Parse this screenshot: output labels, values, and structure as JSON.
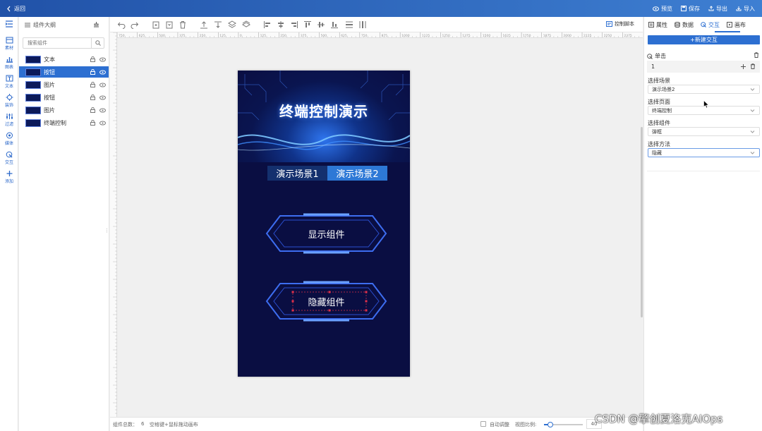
{
  "topbar": {
    "back_label": "返回",
    "actions": [
      {
        "icon": "eye-icon",
        "label": "预览"
      },
      {
        "icon": "save-icon",
        "label": "保存"
      },
      {
        "icon": "export-icon",
        "label": "导出"
      },
      {
        "icon": "import-icon",
        "label": "导入"
      }
    ]
  },
  "leftnav": [
    {
      "icon": "material-icon",
      "label": "素材"
    },
    {
      "icon": "chart-icon",
      "label": "图表"
    },
    {
      "icon": "text-icon",
      "label": "文本"
    },
    {
      "icon": "decoration-icon",
      "label": "装饰"
    },
    {
      "icon": "filter-icon",
      "label": "过滤"
    },
    {
      "icon": "media-icon",
      "label": "媒体"
    },
    {
      "icon": "interaction-icon",
      "label": "交互"
    },
    {
      "icon": "add-icon",
      "label": "添加"
    }
  ],
  "outline": {
    "title": "组件大纲",
    "search_placeholder": "搜索组件",
    "items": [
      {
        "label": "文本",
        "selected": false
      },
      {
        "label": "按钮",
        "selected": true
      },
      {
        "label": "图片",
        "selected": false
      },
      {
        "label": "按钮",
        "selected": false
      },
      {
        "label": "图片",
        "selected": false
      },
      {
        "label": "终端控制",
        "selected": false
      }
    ]
  },
  "toolbar": {
    "control_script_label": "控制脚本"
  },
  "canvas": {
    "title": "终端控制演示",
    "scene_tabs": [
      "演示场景1",
      "演示场景2"
    ],
    "show_button": "显示组件",
    "hide_button": "隐藏组件"
  },
  "rightpanel": {
    "tabs": [
      {
        "icon": "property-icon",
        "label": "属性",
        "active": false
      },
      {
        "icon": "data-icon",
        "label": "数据",
        "active": false
      },
      {
        "icon": "interaction-icon",
        "label": "交互",
        "active": true
      },
      {
        "icon": "canvas-icon",
        "label": "画布",
        "active": false
      }
    ],
    "new_interaction": "+新建交互",
    "event_label": "单击",
    "index": "1",
    "fields": [
      {
        "label": "选择场景",
        "value": "演示场景2"
      },
      {
        "label": "选择页面",
        "value": "终端控制"
      },
      {
        "label": "选择组件",
        "value": "弹框"
      },
      {
        "label": "选择方法",
        "value": "隐藏"
      }
    ]
  },
  "statusbar": {
    "count_label": "组件总数：",
    "count_value": "6",
    "hint": "空格键+鼠标拖动画布",
    "auto_adjust": "自动调整",
    "zoom_label": "视图比例:",
    "zoom_value": "40"
  },
  "watermark": "CSDN @擎创夏洛克AIOps",
  "ruler_ticks": [
    "750",
    "625",
    "500",
    "375",
    "250",
    "125",
    "0",
    "125",
    "250",
    "375",
    "500",
    "625",
    "750",
    "875",
    "1000",
    "1125",
    "1250",
    "1375",
    "1500",
    "1625",
    "1750",
    "1875",
    "2000",
    "2125",
    "2250",
    "2375"
  ],
  "colors": {
    "accent": "#2d6fd1",
    "canvas_bg": "#0a0e42",
    "tab_active": "#2d78d6",
    "tab_inactive": "#14306e"
  }
}
